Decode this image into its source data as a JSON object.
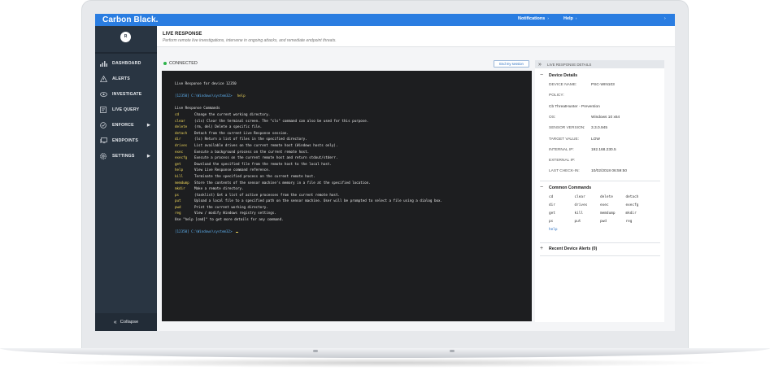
{
  "app": {
    "brand": "Carbon Black."
  },
  "topbar": {
    "notifications": "Notifications",
    "help": "Help"
  },
  "sidebar": {
    "avatar_initial": "R",
    "items": [
      {
        "label": "DASHBOARD",
        "icon": "bar-chart-icon",
        "has_submenu": false
      },
      {
        "label": "ALERTS",
        "icon": "warning-triangle-icon",
        "has_submenu": false
      },
      {
        "label": "INVESTIGATE",
        "icon": "eye-icon",
        "has_submenu": false
      },
      {
        "label": "LIVE QUERY",
        "icon": "query-icon",
        "has_submenu": false
      },
      {
        "label": "ENFORCE",
        "icon": "shield-check-icon",
        "has_submenu": true
      },
      {
        "label": "ENDPOINTS",
        "icon": "monitor-icon",
        "has_submenu": false
      },
      {
        "label": "SETTINGS",
        "icon": "gear-icon",
        "has_submenu": true
      }
    ],
    "collapse_label": "Collapse"
  },
  "header": {
    "title": "LIVE RESPONSE",
    "subtitle": "Perform remote live investigations, intervene in ongoing attacks, and remediate endpoint threats."
  },
  "session": {
    "status": "CONNECTED",
    "status_color": "#2db34a",
    "end_button": "End my session"
  },
  "terminal": {
    "header_line": "Live Response for device 12350",
    "prompt": "[12350] C:\\Windows\\system32>",
    "entered_command": "help",
    "help_title": "Live Response Commands",
    "commands": [
      {
        "name": "cd",
        "desc": "Change the current working directory."
      },
      {
        "name": "clear",
        "desc": "(cls) Clear the terminal screen. The \"cls\" command can also be used for this purpose."
      },
      {
        "name": "delete",
        "desc": "(rm, del) Delete a specific file."
      },
      {
        "name": "detach",
        "desc": "Detach from the current Live Response session."
      },
      {
        "name": "dir",
        "desc": "(ls) Return a list of files in the specified directory."
      },
      {
        "name": "drives",
        "desc": "List available drives on the current remote host (Windows hosts only)."
      },
      {
        "name": "exec",
        "desc": "Execute a background process on the current remote host."
      },
      {
        "name": "execfg",
        "desc": "Execute a process on the current remote host and return stdout/stderr."
      },
      {
        "name": "get",
        "desc": "Download the specified file from the remote host to the local host."
      },
      {
        "name": "help",
        "desc": "View Live Response command reference."
      },
      {
        "name": "kill",
        "desc": "Terminate the specified process on the current remote host."
      },
      {
        "name": "memdump",
        "desc": "Store the contents of the sensor machine's memory in a file at the specified location."
      },
      {
        "name": "mkdir",
        "desc": "Make a remote directory."
      },
      {
        "name": "ps",
        "desc": "(tasklist) Get a list of active processes from the current remote host."
      },
      {
        "name": "put",
        "desc": "Upload a local file to a specified path on the sensor machine. User will be prompted to select a file using a dialog box."
      },
      {
        "name": "pwd",
        "desc": "Print the current working directory."
      },
      {
        "name": "reg",
        "desc": "View / modify Windows registry settings."
      }
    ],
    "footer_hint": "Use \"help [cmd]\" to get more details for any command.",
    "second_prompt": "[12350] C:\\Windows\\system32>"
  },
  "details_panel": {
    "title": "LIVE RESPONSE DETAILS",
    "device_section": "Device Details",
    "device": [
      {
        "key": "DEVICE NAME:",
        "value": "PSC-WIN103"
      },
      {
        "key": "POLICY:",
        "value": ""
      },
      {
        "key": "",
        "value": "Cb ThreatHunter - Prevention"
      },
      {
        "key": "OS:",
        "value": "Windows 10 x64"
      },
      {
        "key": "SENSOR VERSION:",
        "value": "3.3.0.945"
      },
      {
        "key": "TARGET VALUE:",
        "value": "LOW"
      },
      {
        "key": "INTERNAL IP:",
        "value": "192.168.230.5"
      },
      {
        "key": "EXTERNAL IP:",
        "value": ""
      },
      {
        "key": "LAST CHECK-IN:",
        "value": "10/02/2018 06:59:50"
      }
    ],
    "common_section": "Common Commands",
    "common_commands": [
      "cd",
      "clear",
      "delete",
      "detach",
      "dir",
      "drives",
      "exec",
      "execfg",
      "get",
      "kill",
      "memdump",
      "mkdir",
      "ps",
      "put",
      "pwd",
      "reg",
      "help"
    ],
    "alerts_section": "Recent Device Alerts (0)"
  }
}
